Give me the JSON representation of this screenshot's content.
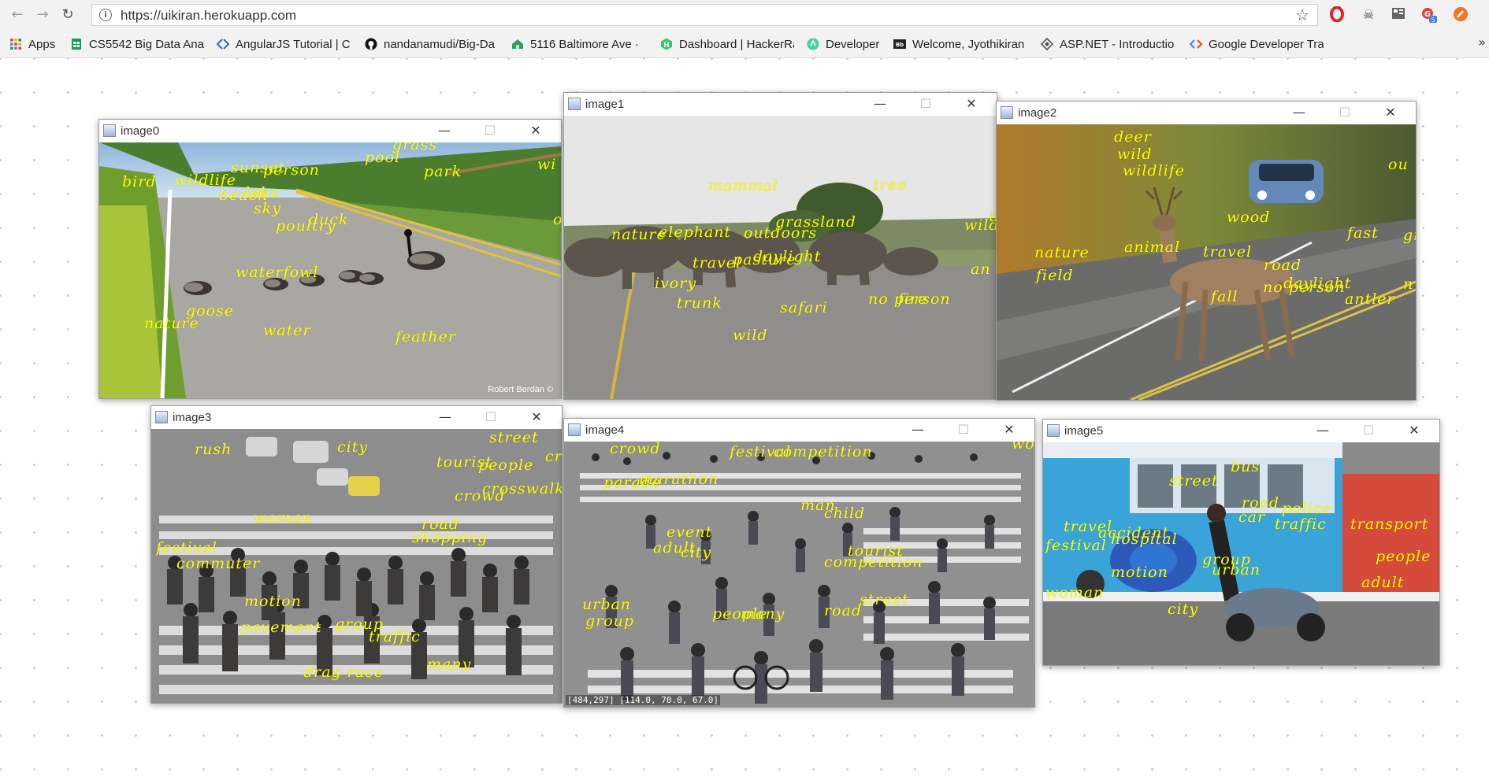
{
  "browser": {
    "url": "https://uikiran.herokuapp.com",
    "nav": {
      "back_icon": "←",
      "forward_icon": "→",
      "reload_icon": "↻",
      "star_icon": "☆"
    },
    "bookmarks": [
      {
        "label": "Apps",
        "icon": "apps-grid",
        "color": "#e0443b"
      },
      {
        "label": "CS5542 Big Data Anal",
        "icon": "sheets",
        "color": "#0f9d58"
      },
      {
        "label": "AngularJS Tutorial | C",
        "icon": "angle",
        "color": "#1e6cc7"
      },
      {
        "label": "nandanamudi/Big-Da",
        "icon": "github",
        "color": "#111111"
      },
      {
        "label": "5116 Baltimore Ave ·",
        "icon": "house",
        "color": "#2ea15f"
      },
      {
        "label": "Dashboard | HackerRa",
        "icon": "hackerrank",
        "color": "#2ec866"
      },
      {
        "label": "Developer",
        "icon": "developer",
        "color": "#41d3a0"
      },
      {
        "label": "Welcome, Jyothikiran",
        "icon": "blackboard",
        "color": "#222222"
      },
      {
        "label": "ASP.NET - Introductio",
        "icon": "aspnet",
        "color": "#555555"
      },
      {
        "label": "Google Developer Tra",
        "icon": "google-dev",
        "color": "#4285f4"
      }
    ],
    "more_icon": "»",
    "extension_badge": "5"
  },
  "windows": [
    {
      "title": "image0",
      "labels": [
        {
          "text": "grass"
        },
        {
          "text": "pool"
        },
        {
          "text": "sunset"
        },
        {
          "text": "person"
        },
        {
          "text": "park"
        },
        {
          "text": "wi"
        },
        {
          "text": "bird"
        },
        {
          "text": "wildlife"
        },
        {
          "text": "beach"
        },
        {
          "text": "lake"
        },
        {
          "text": "sky"
        },
        {
          "text": "duck"
        },
        {
          "text": "poultry"
        },
        {
          "text": "waterfowl"
        },
        {
          "text": "goose"
        },
        {
          "text": "nature"
        },
        {
          "text": "water"
        },
        {
          "text": "feather"
        },
        {
          "text": "o"
        }
      ],
      "watermark": "Robert Berdan ©"
    },
    {
      "title": "image1",
      "labels": [
        {
          "text": "mammal"
        },
        {
          "text": "tree"
        },
        {
          "text": "grassland"
        },
        {
          "text": "wild"
        },
        {
          "text": "nature"
        },
        {
          "text": "elephant"
        },
        {
          "text": "outdoors"
        },
        {
          "text": "travel"
        },
        {
          "text": "pasture"
        },
        {
          "text": "daylight"
        },
        {
          "text": "an"
        },
        {
          "text": "ivory"
        },
        {
          "text": "trunk"
        },
        {
          "text": "safari"
        },
        {
          "text": "no person"
        },
        {
          "text": "fire"
        },
        {
          "text": "wild"
        },
        {
          "text": "d"
        }
      ]
    },
    {
      "title": "image2",
      "labels": [
        {
          "text": "deer"
        },
        {
          "text": "wild"
        },
        {
          "text": "wildlife"
        },
        {
          "text": "ou"
        },
        {
          "text": "wood"
        },
        {
          "text": "fast"
        },
        {
          "text": "gr"
        },
        {
          "text": "nature"
        },
        {
          "text": "animal"
        },
        {
          "text": "travel"
        },
        {
          "text": "road"
        },
        {
          "text": "field"
        },
        {
          "text": "daylight"
        },
        {
          "text": "no person"
        },
        {
          "text": "fall"
        },
        {
          "text": "antler"
        },
        {
          "text": "n"
        }
      ]
    },
    {
      "title": "image3",
      "labels": [
        {
          "text": "rush"
        },
        {
          "text": "city"
        },
        {
          "text": "street"
        },
        {
          "text": "tourist"
        },
        {
          "text": "people"
        },
        {
          "text": "crosswalk"
        },
        {
          "text": "crowd"
        },
        {
          "text": "crossing"
        },
        {
          "text": "woman"
        },
        {
          "text": "road"
        },
        {
          "text": "shopping"
        },
        {
          "text": "festival"
        },
        {
          "text": "commuter"
        },
        {
          "text": "motion"
        },
        {
          "text": "pavement"
        },
        {
          "text": "group"
        },
        {
          "text": "traffic"
        },
        {
          "text": "many"
        },
        {
          "text": "drag race"
        }
      ]
    },
    {
      "title": "image4",
      "labels": [
        {
          "text": "crowd"
        },
        {
          "text": "festival"
        },
        {
          "text": "competition"
        },
        {
          "text": "parade"
        },
        {
          "text": "marathon"
        },
        {
          "text": "man"
        },
        {
          "text": "child"
        },
        {
          "text": "event"
        },
        {
          "text": "adult"
        },
        {
          "text": "city"
        },
        {
          "text": "tourist"
        },
        {
          "text": "competition"
        },
        {
          "text": "urban"
        },
        {
          "text": "group"
        },
        {
          "text": "street"
        },
        {
          "text": "road"
        },
        {
          "text": "people"
        },
        {
          "text": "many"
        },
        {
          "text": "wo"
        }
      ],
      "status": "[484,297] [114.0, 70.0, 67.0]"
    },
    {
      "title": "image5",
      "labels": [
        {
          "text": "bus"
        },
        {
          "text": "street"
        },
        {
          "text": "road"
        },
        {
          "text": "police"
        },
        {
          "text": "car"
        },
        {
          "text": "traffic"
        },
        {
          "text": "transport"
        },
        {
          "text": "travel"
        },
        {
          "text": "accident"
        },
        {
          "text": "hospital"
        },
        {
          "text": "festival"
        },
        {
          "text": "group"
        },
        {
          "text": "motion"
        },
        {
          "text": "urban"
        },
        {
          "text": "people"
        },
        {
          "text": "adult"
        },
        {
          "text": "woman"
        },
        {
          "text": "city"
        }
      ]
    }
  ],
  "window_controls": {
    "minimize": "—",
    "maximize": "☐",
    "close": "✕"
  },
  "colors": {
    "label": "#ffff00",
    "toolbar": "#f2f2f2"
  }
}
